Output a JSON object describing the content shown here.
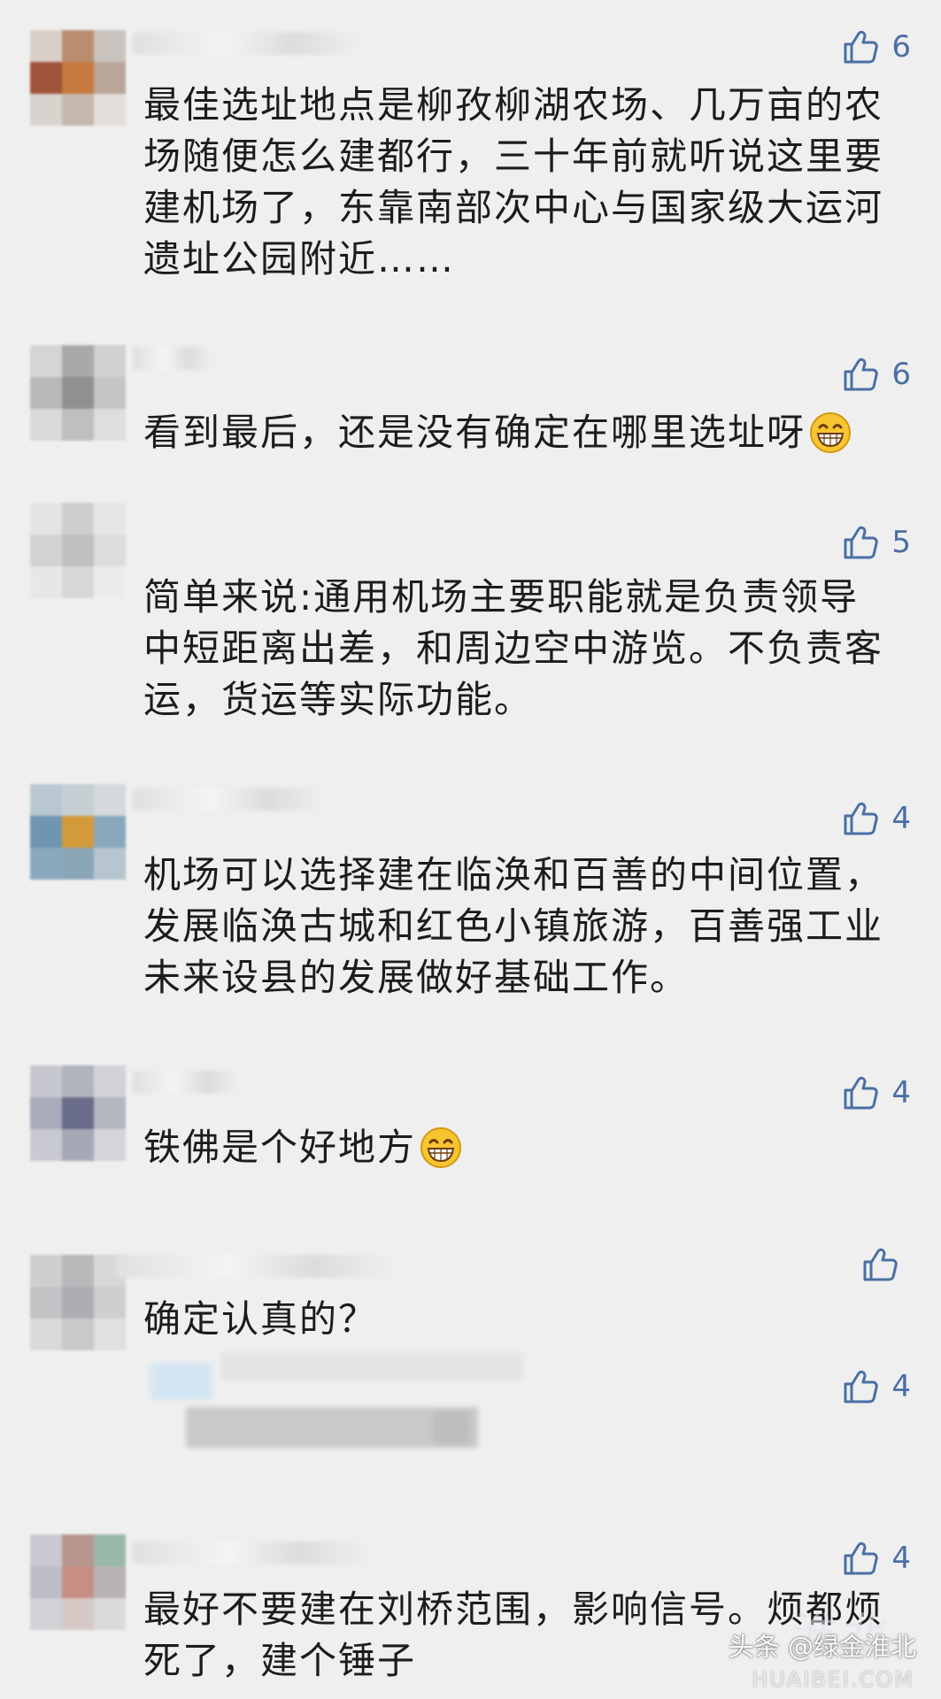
{
  "comments": [
    {
      "likes": "6",
      "text": "最佳选址地点是柳孜柳湖农场、几万亩的农场随便怎么建都行，三十年前就听说这里要建机场了，东靠南部次中心与国家级大运河遗址公园附近……"
    },
    {
      "likes": "6",
      "text": "看到最后，还是没有确定在哪里选址呀"
    },
    {
      "likes": "5",
      "text": "简单来说:通用机场主要职能就是负责领导中短距离出差，和周边空中游览。不负责客运，货运等实际功能。"
    },
    {
      "likes": "4",
      "text": "机场可以选择建在临涣和百善的中间位置，发展临涣古城和红色小镇旅游，百善强工业未来设县的发展做好基础工作。"
    },
    {
      "likes": "4",
      "text": "铁佛是个好地方"
    },
    {
      "likes": "",
      "text": "确定认真的？"
    },
    {
      "likes": "4",
      "text": ""
    },
    {
      "likes": "4",
      "text": "最好不要建在刘桥范围，影响信号。烦都烦死了，建个锤子"
    }
  ],
  "watermark": {
    "source": "头条 @绿金淮北",
    "site": "HUAIBEI.COM"
  },
  "colors": {
    "background": "#efefef",
    "like": "#4a6fa5",
    "text": "#1c1c1c"
  },
  "icons": {
    "like": "thumbs-up-icon",
    "emoji": "grinning-face-icon"
  }
}
